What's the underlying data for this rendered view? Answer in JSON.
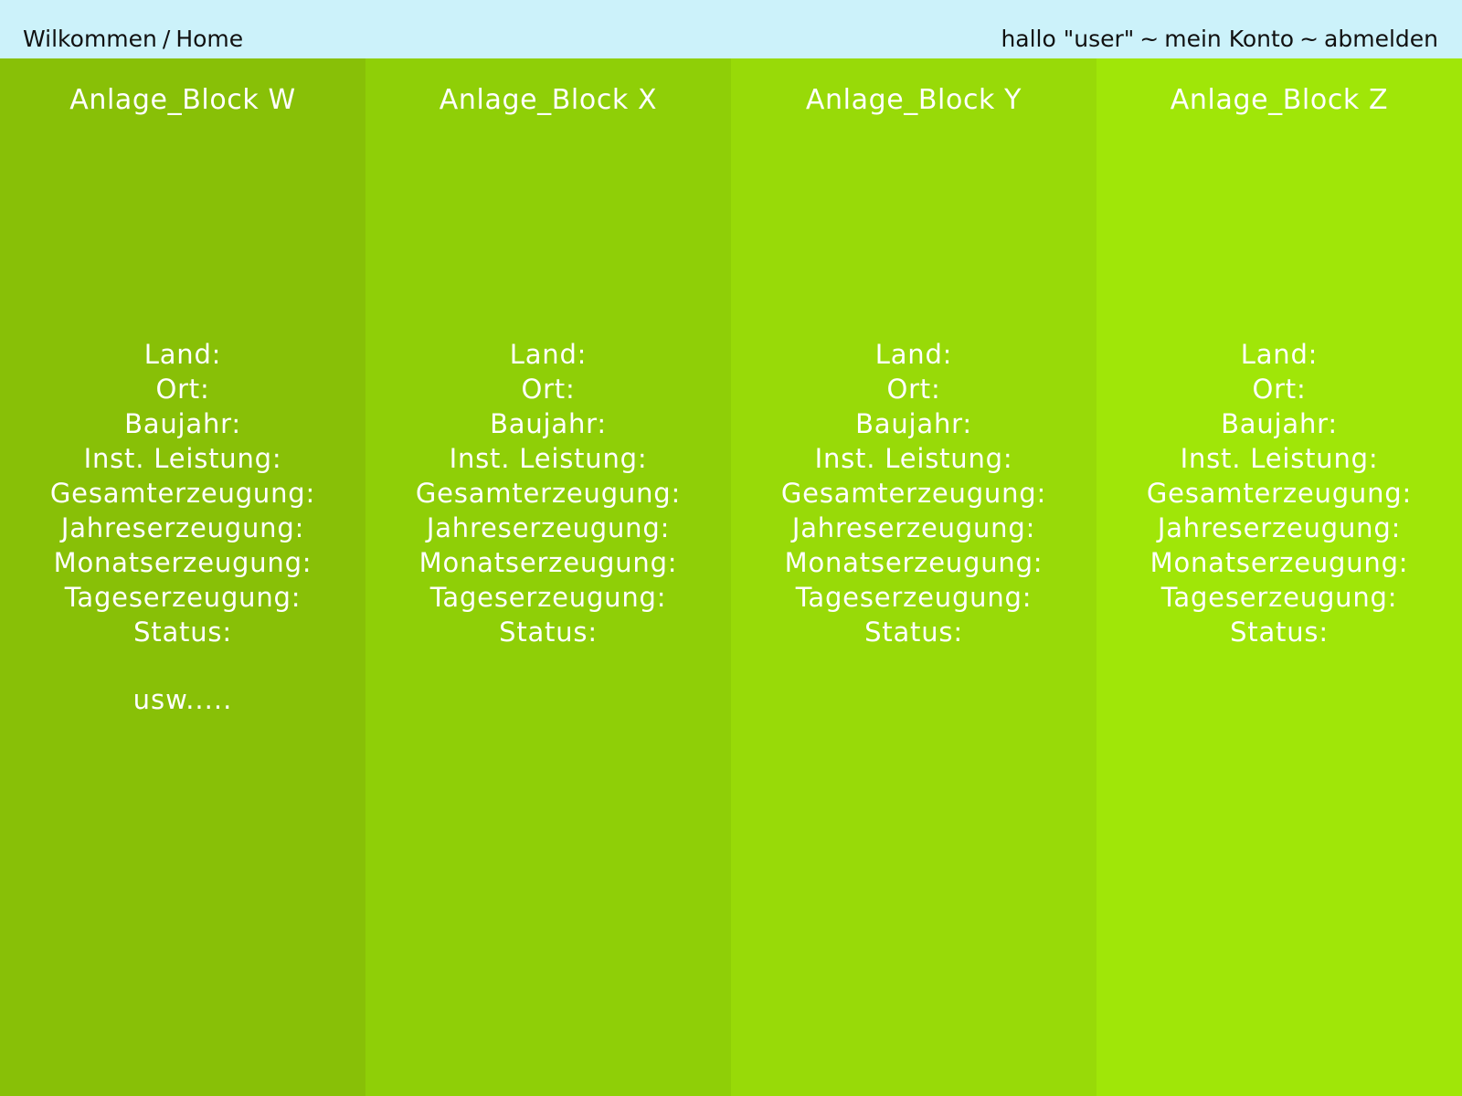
{
  "header": {
    "breadcrumb": {
      "home_welcome": "Wilkommen",
      "separator": "/",
      "home": "Home"
    },
    "user_nav": {
      "greeting": "hallo \"user\"",
      "separator": "~",
      "account": "mein Konto",
      "logout": "abmelden"
    },
    "background_color": "#ccf2fa"
  },
  "columns": [
    {
      "title": "Anlage_Block W",
      "background_color": "#88c007",
      "fields": [
        "Land:",
        "Ort:",
        "Baujahr:",
        "Inst. Leistung:",
        "Gesamterzeugung:",
        "Jahreserzeugung:",
        "Monatserzeugung:",
        "Tageserzeugung:",
        "Status:"
      ],
      "more": "usw....."
    },
    {
      "title": "Anlage_Block X",
      "background_color": "#8fcf07",
      "fields": [
        "Land:",
        "Ort:",
        "Baujahr:",
        "Inst. Leistung:",
        "Gesamterzeugung:",
        "Jahreserzeugung:",
        "Monatserzeugung:",
        "Tageserzeugung:",
        "Status:"
      ],
      "more": ""
    },
    {
      "title": "Anlage_Block Y",
      "background_color": "#98da08",
      "fields": [
        "Land:",
        "Ort:",
        "Baujahr:",
        "Inst. Leistung:",
        "Gesamterzeugung:",
        "Jahreserzeugung:",
        "Monatserzeugung:",
        "Tageserzeugung:",
        "Status:"
      ],
      "more": ""
    },
    {
      "title": "Anlage_Block Z",
      "background_color": "#a0e608",
      "fields": [
        "Land:",
        "Ort:",
        "Baujahr:",
        "Inst. Leistung:",
        "Gesamterzeugung:",
        "Jahreserzeugung:",
        "Monatserzeugung:",
        "Tageserzeugung:",
        "Status:"
      ],
      "more": ""
    }
  ]
}
